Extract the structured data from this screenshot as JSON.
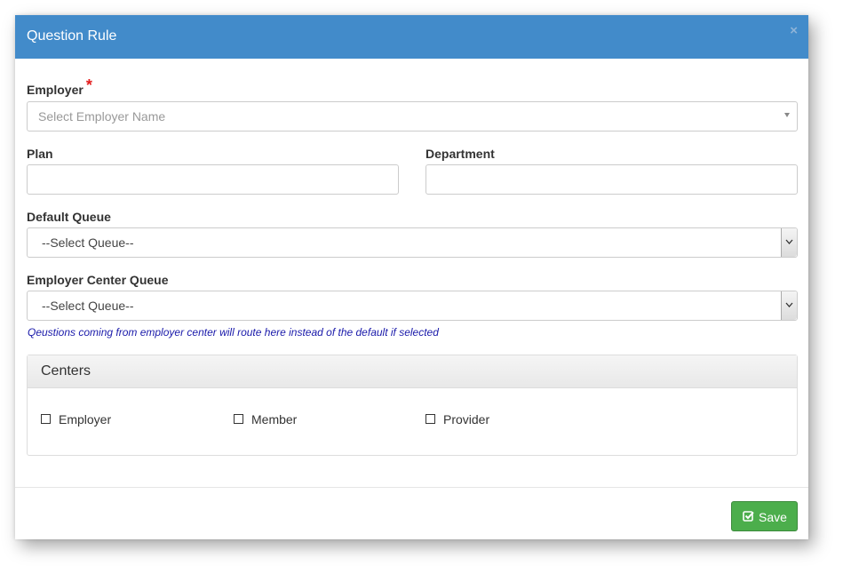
{
  "modal": {
    "title": "Question Rule",
    "close_label": "×"
  },
  "form": {
    "employer": {
      "label": "Employer",
      "required_mark": "*",
      "placeholder": "Select Employer Name"
    },
    "plan": {
      "label": "Plan",
      "value": ""
    },
    "department": {
      "label": "Department",
      "value": ""
    },
    "default_queue": {
      "label": "Default Queue",
      "selected": "--Select Queue--"
    },
    "employer_center_queue": {
      "label": "Employer Center Queue",
      "selected": "--Select Queue--",
      "help": "Qeustions coming from employer center will route here instead of the default if selected"
    }
  },
  "centers": {
    "title": "Centers",
    "options": [
      {
        "label": "Employer",
        "checked": false
      },
      {
        "label": "Member",
        "checked": false
      },
      {
        "label": "Provider",
        "checked": false
      }
    ]
  },
  "footer": {
    "save_label": "Save",
    "save_icon": "check-square-icon"
  },
  "colors": {
    "header": "#428bca",
    "save": "#4cae4c",
    "required": "#e31d1d",
    "help": "#1a1aaa"
  }
}
